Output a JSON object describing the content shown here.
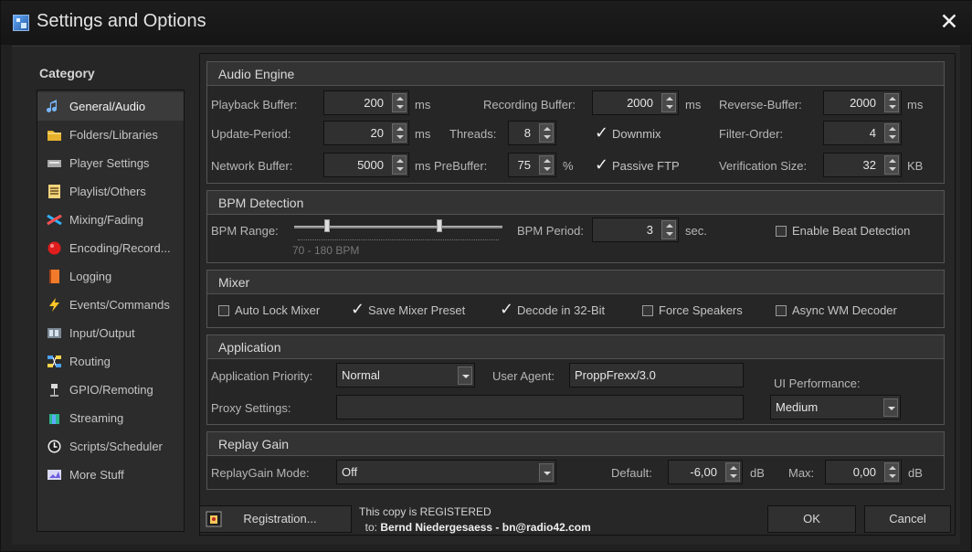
{
  "window": {
    "title": "Settings and Options",
    "close_glyph": "✕"
  },
  "sidebar": {
    "category": "Category",
    "items": [
      {
        "label": "General/Audio",
        "icon": "music-note-icon",
        "active": true
      },
      {
        "label": "Folders/Libraries",
        "icon": "folder-icon"
      },
      {
        "label": "Player Settings",
        "icon": "player-icon"
      },
      {
        "label": "Playlist/Others",
        "icon": "playlist-icon"
      },
      {
        "label": "Mixing/Fading",
        "icon": "mixing-icon"
      },
      {
        "label": "Encoding/Record...",
        "icon": "record-icon"
      },
      {
        "label": "Logging",
        "icon": "log-book-icon"
      },
      {
        "label": "Events/Commands",
        "icon": "lightning-icon"
      },
      {
        "label": "Input/Output",
        "icon": "input-output-icon"
      },
      {
        "label": "Routing",
        "icon": "routing-icon"
      },
      {
        "label": "GPIO/Remoting",
        "icon": "gpio-icon"
      },
      {
        "label": "Streaming",
        "icon": "streaming-icon"
      },
      {
        "label": "Scripts/Scheduler",
        "icon": "clock-icon"
      },
      {
        "label": "More Stuff",
        "icon": "more-stuff-icon"
      }
    ]
  },
  "audio_engine": {
    "title": "Audio Engine",
    "playback_buffer_label": "Playback Buffer:",
    "playback_buffer": "200",
    "recording_buffer_label": "Recording Buffer:",
    "recording_buffer": "2000",
    "reverse_buffer_label": "Reverse-Buffer:",
    "reverse_buffer": "2000",
    "update_period_label": "Update-Period:",
    "update_period": "20",
    "threads_label": "Threads:",
    "threads": "8",
    "downmix_label": "Downmix",
    "filter_order_label": "Filter-Order:",
    "filter_order": "4",
    "network_buffer_label": "Network Buffer:",
    "network_buffer": "5000",
    "prebuffer_label": "PreBuffer:",
    "prebuffer": "75",
    "passive_ftp_label": "Passive FTP",
    "verification_size_label": "Verification Size:",
    "verification_size": "32",
    "unit_ms": "ms",
    "unit_percent": "%",
    "unit_kb": "KB"
  },
  "bpm": {
    "title": "BPM Detection",
    "range_label": "BPM Range:",
    "range_value": "70 - 180 BPM",
    "period_label": "BPM Period:",
    "period": "3",
    "period_unit": "sec.",
    "enable_label": "Enable Beat Detection"
  },
  "mixer": {
    "title": "Mixer",
    "auto_lock": "Auto Lock Mixer",
    "save_preset": "Save Mixer Preset",
    "decode_32": "Decode in 32-Bit",
    "force_speakers": "Force Speakers",
    "async_wm": "Async WM Decoder"
  },
  "application": {
    "title": "Application",
    "priority_label": "Application Priority:",
    "priority": "Normal",
    "user_agent_label": "User Agent:",
    "user_agent": "ProppFrexx/3.0",
    "ui_performance_label": "UI Performance:",
    "ui_performance": "Medium",
    "proxy_label": "Proxy Settings:",
    "proxy": ""
  },
  "replay_gain": {
    "title": "Replay Gain",
    "mode_label": "ReplayGain Mode:",
    "mode": "Off",
    "default_label": "Default:",
    "default": "-6,00",
    "max_label": "Max:",
    "max": "0,00",
    "unit_db": "dB"
  },
  "footer": {
    "registration_button": "Registration...",
    "registered_line": "This copy is REGISTERED",
    "to_label": "to:",
    "registered_to": "Bernd Niedergesaess - bn@radio42.com",
    "ok": "OK",
    "cancel": "Cancel"
  }
}
